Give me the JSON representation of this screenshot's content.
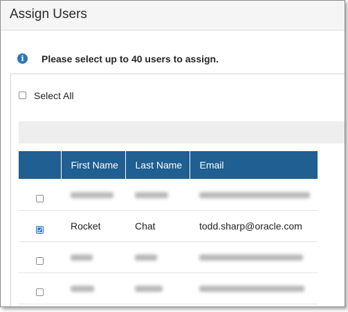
{
  "dialog": {
    "title": "Assign Users"
  },
  "info": {
    "icon": "info-icon",
    "message": "Please select up to 40 users to assign."
  },
  "select_all": {
    "label": "Select All",
    "checked": false
  },
  "table": {
    "columns": [
      "",
      "First Name",
      "Last Name",
      "Email"
    ],
    "rows": [
      {
        "checked": false,
        "first_name": "",
        "last_name": "",
        "email": "",
        "obscured": true
      },
      {
        "checked": true,
        "first_name": "Rocket",
        "last_name": "Chat",
        "email": "todd.sharp@oracle.com",
        "obscured": false
      },
      {
        "checked": false,
        "first_name": "",
        "last_name": "",
        "email": "",
        "obscured": true
      },
      {
        "checked": false,
        "first_name": "",
        "last_name": "",
        "email": "",
        "obscured": true
      }
    ]
  },
  "colors": {
    "header_bg": "#1f5f91",
    "info_icon": "#2f76b8",
    "checkbox_checked": "#2f80d1"
  }
}
